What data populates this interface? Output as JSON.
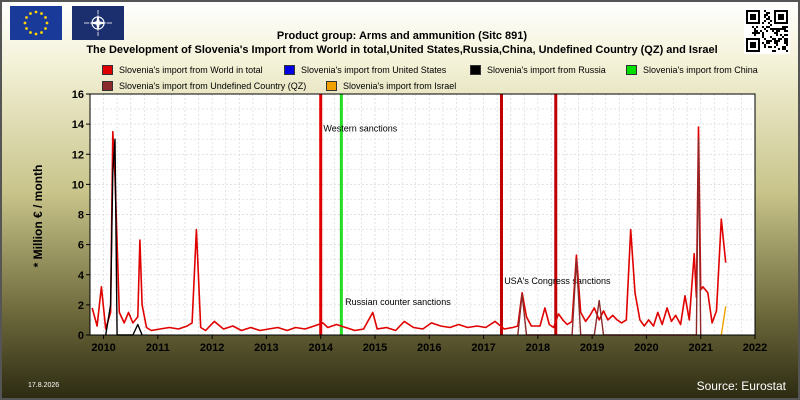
{
  "header": {
    "title_line1": "Product group: Arms and ammunition (Sitc 891)",
    "title_line2": "The Development of Slovenia's Import from World in total,United States,Russia,China, Undefined Country (QZ) and Israel"
  },
  "footer": {
    "date": "17.8.2026",
    "source": "Source: Eurostat"
  },
  "chart_data": {
    "type": "line",
    "title": "Product group: Arms and ammunition (Sitc 891)",
    "subtitle": "The Development of Slovenia's Import from World in total,United States,Russia,China, Undefined Country (QZ) and Israel",
    "ylabel": "* Million € / month",
    "xlabel": "",
    "xlim": [
      2009.75,
      2022.0
    ],
    "ylim": [
      0,
      16
    ],
    "x_ticks": [
      2010,
      2011,
      2012,
      2013,
      2014,
      2015,
      2016,
      2017,
      2018,
      2019,
      2020,
      2021,
      2022
    ],
    "y_ticks": [
      0,
      2,
      4,
      6,
      8,
      10,
      12,
      14,
      16
    ],
    "grid": true,
    "legend_position": "top",
    "series": [
      {
        "name": "Slovenia's import from World in total",
        "color": "#e00000",
        "points": [
          [
            2009.79,
            1.8
          ],
          [
            2009.88,
            0.6
          ],
          [
            2009.96,
            3.2
          ],
          [
            2010.04,
            0.4
          ],
          [
            2010.13,
            1.5
          ],
          [
            2010.17,
            13.5
          ],
          [
            2010.21,
            10.5
          ],
          [
            2010.29,
            1.5
          ],
          [
            2010.38,
            0.8
          ],
          [
            2010.46,
            1.5
          ],
          [
            2010.54,
            0.8
          ],
          [
            2010.63,
            1.2
          ],
          [
            2010.67,
            6.3
          ],
          [
            2010.71,
            2.0
          ],
          [
            2010.79,
            0.5
          ],
          [
            2010.88,
            0.3
          ],
          [
            2011.04,
            0.4
          ],
          [
            2011.21,
            0.5
          ],
          [
            2011.38,
            0.4
          ],
          [
            2011.54,
            0.6
          ],
          [
            2011.63,
            0.8
          ],
          [
            2011.71,
            7.0
          ],
          [
            2011.79,
            0.5
          ],
          [
            2011.88,
            0.3
          ],
          [
            2012.04,
            0.9
          ],
          [
            2012.21,
            0.4
          ],
          [
            2012.38,
            0.6
          ],
          [
            2012.54,
            0.3
          ],
          [
            2012.71,
            0.5
          ],
          [
            2012.88,
            0.3
          ],
          [
            2013.04,
            0.4
          ],
          [
            2013.21,
            0.5
          ],
          [
            2013.38,
            0.3
          ],
          [
            2013.54,
            0.5
          ],
          [
            2013.71,
            0.4
          ],
          [
            2013.88,
            0.6
          ],
          [
            2014.04,
            0.8
          ],
          [
            2014.13,
            0.5
          ],
          [
            2014.29,
            0.7
          ],
          [
            2014.46,
            0.5
          ],
          [
            2014.63,
            0.3
          ],
          [
            2014.79,
            0.4
          ],
          [
            2014.96,
            1.5
          ],
          [
            2015.04,
            0.4
          ],
          [
            2015.21,
            0.5
          ],
          [
            2015.38,
            0.3
          ],
          [
            2015.54,
            0.9
          ],
          [
            2015.71,
            0.5
          ],
          [
            2015.88,
            0.4
          ],
          [
            2016.04,
            0.8
          ],
          [
            2016.21,
            0.6
          ],
          [
            2016.38,
            0.5
          ],
          [
            2016.54,
            0.7
          ],
          [
            2016.71,
            0.5
          ],
          [
            2016.88,
            0.6
          ],
          [
            2017.04,
            0.5
          ],
          [
            2017.21,
            0.9
          ],
          [
            2017.38,
            0.4
          ],
          [
            2017.54,
            0.5
          ],
          [
            2017.63,
            0.6
          ],
          [
            2017.71,
            2.8
          ],
          [
            2017.79,
            1.2
          ],
          [
            2017.88,
            0.6
          ],
          [
            2018.04,
            0.6
          ],
          [
            2018.13,
            1.8
          ],
          [
            2018.21,
            0.7
          ],
          [
            2018.29,
            0.5
          ],
          [
            2018.38,
            1.4
          ],
          [
            2018.46,
            1.0
          ],
          [
            2018.54,
            0.7
          ],
          [
            2018.63,
            0.9
          ],
          [
            2018.71,
            5.3
          ],
          [
            2018.79,
            1.5
          ],
          [
            2018.88,
            0.9
          ],
          [
            2018.96,
            1.3
          ],
          [
            2019.04,
            1.8
          ],
          [
            2019.13,
            1.0
          ],
          [
            2019.21,
            1.6
          ],
          [
            2019.29,
            1.0
          ],
          [
            2019.38,
            1.3
          ],
          [
            2019.46,
            1.0
          ],
          [
            2019.54,
            0.8
          ],
          [
            2019.63,
            1.0
          ],
          [
            2019.71,
            7.0
          ],
          [
            2019.79,
            2.8
          ],
          [
            2019.88,
            1.0
          ],
          [
            2019.96,
            0.6
          ],
          [
            2020.04,
            1.0
          ],
          [
            2020.13,
            0.6
          ],
          [
            2020.21,
            1.5
          ],
          [
            2020.29,
            0.7
          ],
          [
            2020.38,
            1.8
          ],
          [
            2020.46,
            0.9
          ],
          [
            2020.54,
            1.3
          ],
          [
            2020.63,
            0.7
          ],
          [
            2020.71,
            2.6
          ],
          [
            2020.79,
            1.0
          ],
          [
            2020.88,
            5.4
          ],
          [
            2020.92,
            2.5
          ],
          [
            2020.96,
            13.8
          ],
          [
            2021.0,
            3.0
          ],
          [
            2021.04,
            3.2
          ],
          [
            2021.13,
            2.8
          ],
          [
            2021.21,
            0.8
          ],
          [
            2021.29,
            1.6
          ],
          [
            2021.38,
            7.7
          ],
          [
            2021.46,
            4.8
          ]
        ]
      },
      {
        "name": "Slovenia's import from United States",
        "color": "#0000e0",
        "points": []
      },
      {
        "name": "Slovenia's import from Russia",
        "color": "#000000",
        "points": [
          [
            2010.04,
            0.0
          ],
          [
            2010.13,
            2.0
          ],
          [
            2010.17,
            10.8
          ],
          [
            2010.21,
            13.0
          ],
          [
            2010.25,
            0.0
          ],
          [
            2010.54,
            0.0
          ],
          [
            2010.63,
            0.7
          ],
          [
            2010.71,
            0.0
          ]
        ]
      },
      {
        "name": "Slovenia's import from China",
        "color": "#00e000",
        "points": []
      },
      {
        "name": "Slovenia's import from Undefined Country (QZ)",
        "color": "#8b2a2a",
        "points": [
          [
            2017.63,
            0.0
          ],
          [
            2017.71,
            2.7
          ],
          [
            2017.79,
            0.0
          ],
          [
            2018.63,
            0.0
          ],
          [
            2018.71,
            5.0
          ],
          [
            2018.79,
            0.0
          ],
          [
            2019.04,
            0.0
          ],
          [
            2019.13,
            2.3
          ],
          [
            2019.21,
            0.0
          ],
          [
            2020.92,
            0.0
          ],
          [
            2020.96,
            13.0
          ],
          [
            2021.0,
            0.0
          ]
        ]
      },
      {
        "name": "Slovenia's import from Israel",
        "color": "#f0a000",
        "points": [
          [
            2021.38,
            0.0
          ],
          [
            2021.46,
            1.9
          ]
        ]
      }
    ],
    "event_lines": [
      {
        "x": 2014.0,
        "color": "#e00000",
        "label": "Western sanctions"
      },
      {
        "x": 2014.38,
        "color": "#22dd22",
        "label": "Russian counter sanctions"
      },
      {
        "x": 2017.33,
        "color": "#c00000",
        "label": "USA's Congress sanctions"
      },
      {
        "x": 2018.33,
        "color": "#c00000",
        "label": ""
      }
    ]
  }
}
